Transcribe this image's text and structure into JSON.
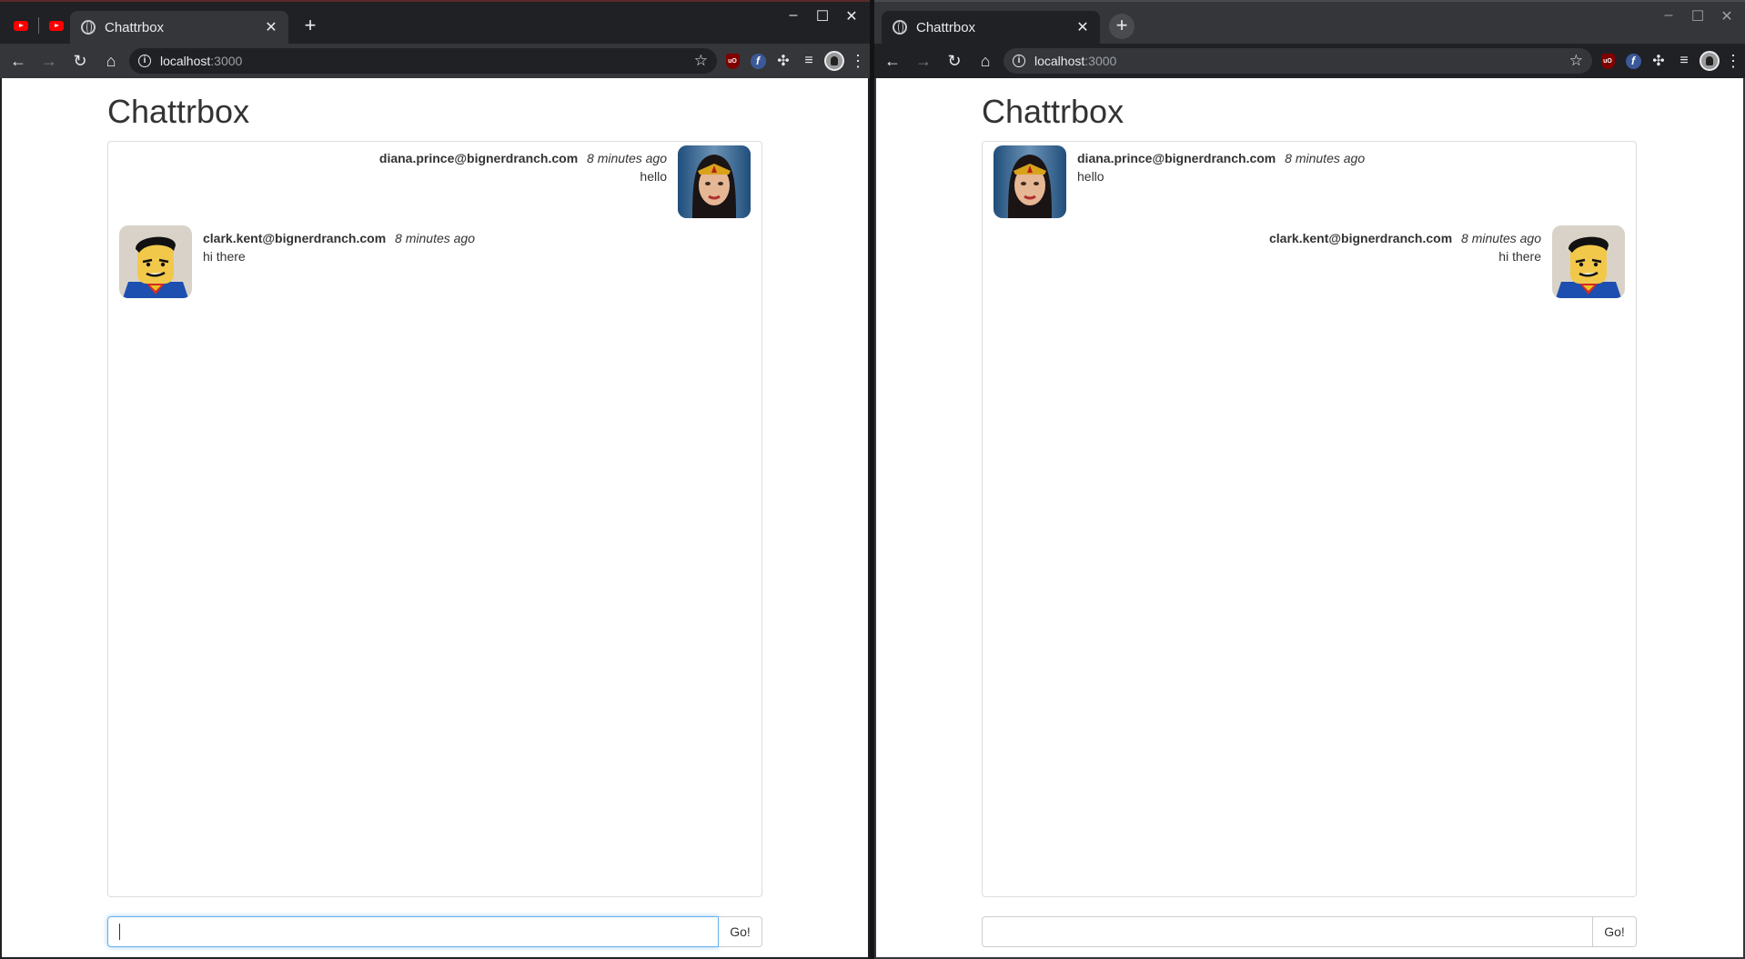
{
  "windows": [
    {
      "tab_title": "Chattrbox",
      "url_host": "localhost",
      "url_port": ":3000",
      "app_title": "Chattrbox",
      "messages": [
        {
          "user": "diana.prince@bignerdranch.com",
          "time": "8 minutes ago",
          "text": "hello",
          "avatar": "wonder-woman-avatar",
          "side": "mine"
        },
        {
          "user": "clark.kent@bignerdranch.com",
          "time": "8 minutes ago",
          "text": "hi there",
          "avatar": "superman-avatar",
          "side": "theirs"
        }
      ],
      "input_value": "",
      "send_label": "Go!"
    },
    {
      "tab_title": "Chattrbox",
      "url_host": "localhost",
      "url_port": ":3000",
      "app_title": "Chattrbox",
      "messages": [
        {
          "user": "diana.prince@bignerdranch.com",
          "time": "8 minutes ago",
          "text": "hello",
          "avatar": "wonder-woman-avatar",
          "side": "theirs"
        },
        {
          "user": "clark.kent@bignerdranch.com",
          "time": "8 minutes ago",
          "text": "hi there",
          "avatar": "superman-avatar",
          "side": "mine"
        }
      ],
      "input_value": "",
      "send_label": "Go!"
    }
  ],
  "icons": {
    "new_tab": "+",
    "close": "✕",
    "minimize": "–",
    "maximize": "☐",
    "back": "←",
    "forward": "→",
    "reload": "↻",
    "home": "⌂",
    "star": "☆",
    "menu": "⋮",
    "puzzle": "✣",
    "queue": "≡",
    "info": "i",
    "ublock_text": "uO",
    "ffz_text": "f"
  },
  "colors": {
    "focus": "#66afe9",
    "youtube": "#ff0000"
  }
}
